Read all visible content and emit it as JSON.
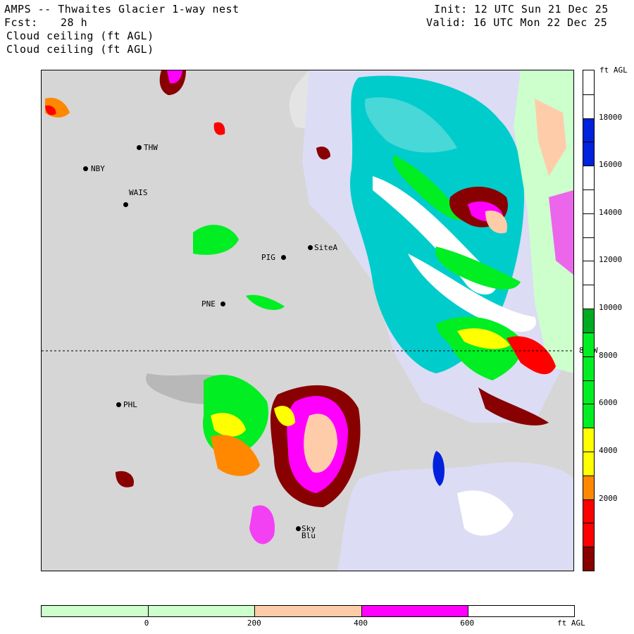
{
  "header": {
    "title": "AMPS -- Thwaites Glacier 1-way nest",
    "init": "Init: 12 UTC Sun 21 Dec 25",
    "fcst_label": "Fcst:",
    "fcst_value": "28 h",
    "valid": "Valid: 16 UTC Mon 22 Dec 25",
    "field1": "Cloud ceiling (ft AGL)",
    "field2": "Cloud ceiling (ft AGL)"
  },
  "stations": [
    {
      "name": "THW",
      "side": "right"
    },
    {
      "name": "NBY",
      "side": "right"
    },
    {
      "name": "WAIS",
      "side": "above"
    },
    {
      "name": "SiteA",
      "side": "right"
    },
    {
      "name": "PIG",
      "side": "left"
    },
    {
      "name": "PNE",
      "side": "left"
    },
    {
      "name": "PHL",
      "side": "right"
    },
    {
      "name": "Sky",
      "side": "right"
    },
    {
      "name": "Blu",
      "side": "right"
    }
  ],
  "latline_label": "80 W",
  "right_colorbar": {
    "unit": "ft AGL",
    "colors": [
      "#ffffff",
      "#ffffff",
      "#0022dd",
      "#0022dd",
      "#ffffff",
      "#ffffff",
      "#ffffff",
      "#ffffff",
      "#ffffff",
      "#ffffff",
      "#00aa22",
      "#00ee22",
      "#00ee22",
      "#00ee22",
      "#00ee22",
      "#ffff00",
      "#ffff00",
      "#ff8800",
      "#ff0000",
      "#ff0000",
      "#880000"
    ],
    "labels": [
      "18000",
      "16000",
      "14000",
      "12000",
      "10000",
      "8000",
      "6000",
      "4000",
      "2000"
    ]
  },
  "bottom_colorbar": {
    "unit": "ft AGL",
    "colors": [
      "#ccffcc",
      "#ccffcc",
      "#ffccaa",
      "#ff00ff",
      "#ffffff"
    ],
    "labels": [
      "0",
      "200",
      "400",
      "600"
    ]
  }
}
